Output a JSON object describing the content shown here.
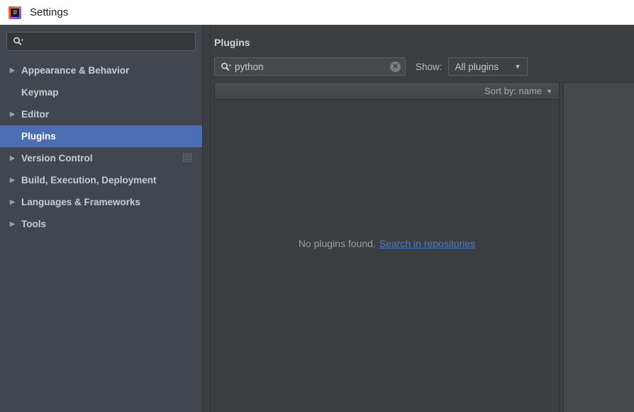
{
  "window": {
    "title": "Settings",
    "logo_icon": "intellij-idea-logo",
    "logo_text": "IJ"
  },
  "sidebar": {
    "search": {
      "value": "",
      "placeholder": "",
      "icon": "search-icon"
    },
    "items": [
      {
        "label": "Appearance & Behavior",
        "arrow": "▶",
        "expandable": true,
        "selected": false,
        "badge": ""
      },
      {
        "label": "Keymap",
        "arrow": "",
        "expandable": false,
        "selected": false,
        "badge": ""
      },
      {
        "label": "Editor",
        "arrow": "▶",
        "expandable": true,
        "selected": false,
        "badge": ""
      },
      {
        "label": "Plugins",
        "arrow": "",
        "expandable": false,
        "selected": true,
        "badge": ""
      },
      {
        "label": "Version Control",
        "arrow": "▶",
        "expandable": true,
        "selected": false,
        "badge": "copy-icon"
      },
      {
        "label": "Build, Execution, Deployment",
        "arrow": "▶",
        "expandable": true,
        "selected": false,
        "badge": ""
      },
      {
        "label": "Languages & Frameworks",
        "arrow": "▶",
        "expandable": true,
        "selected": false,
        "badge": ""
      },
      {
        "label": "Tools",
        "arrow": "▶",
        "expandable": true,
        "selected": false,
        "badge": ""
      }
    ]
  },
  "main": {
    "title": "Plugins",
    "search": {
      "value": "python",
      "placeholder": "",
      "icon": "search-icon",
      "clear_icon": "clear-circle-icon",
      "clear_glyph": "✕"
    },
    "show": {
      "label": "Show:",
      "selected": "All plugins",
      "caret": "▼"
    },
    "sort": {
      "label": "Sort by: name",
      "caret": "▼"
    },
    "empty_state": {
      "message": "No plugins found.",
      "link": "Search in repositories"
    }
  },
  "colors": {
    "titlebar_bg": "#ffffff",
    "titlebar_text": "#1a1a1a",
    "sidebar_bg": "#41464f",
    "panel_bg": "#3c3f41",
    "selection_blue": "#4b6eb5",
    "link_blue": "#4f7bc4",
    "text_primary": "#c9ccd1",
    "text_muted": "#9a9da0"
  }
}
